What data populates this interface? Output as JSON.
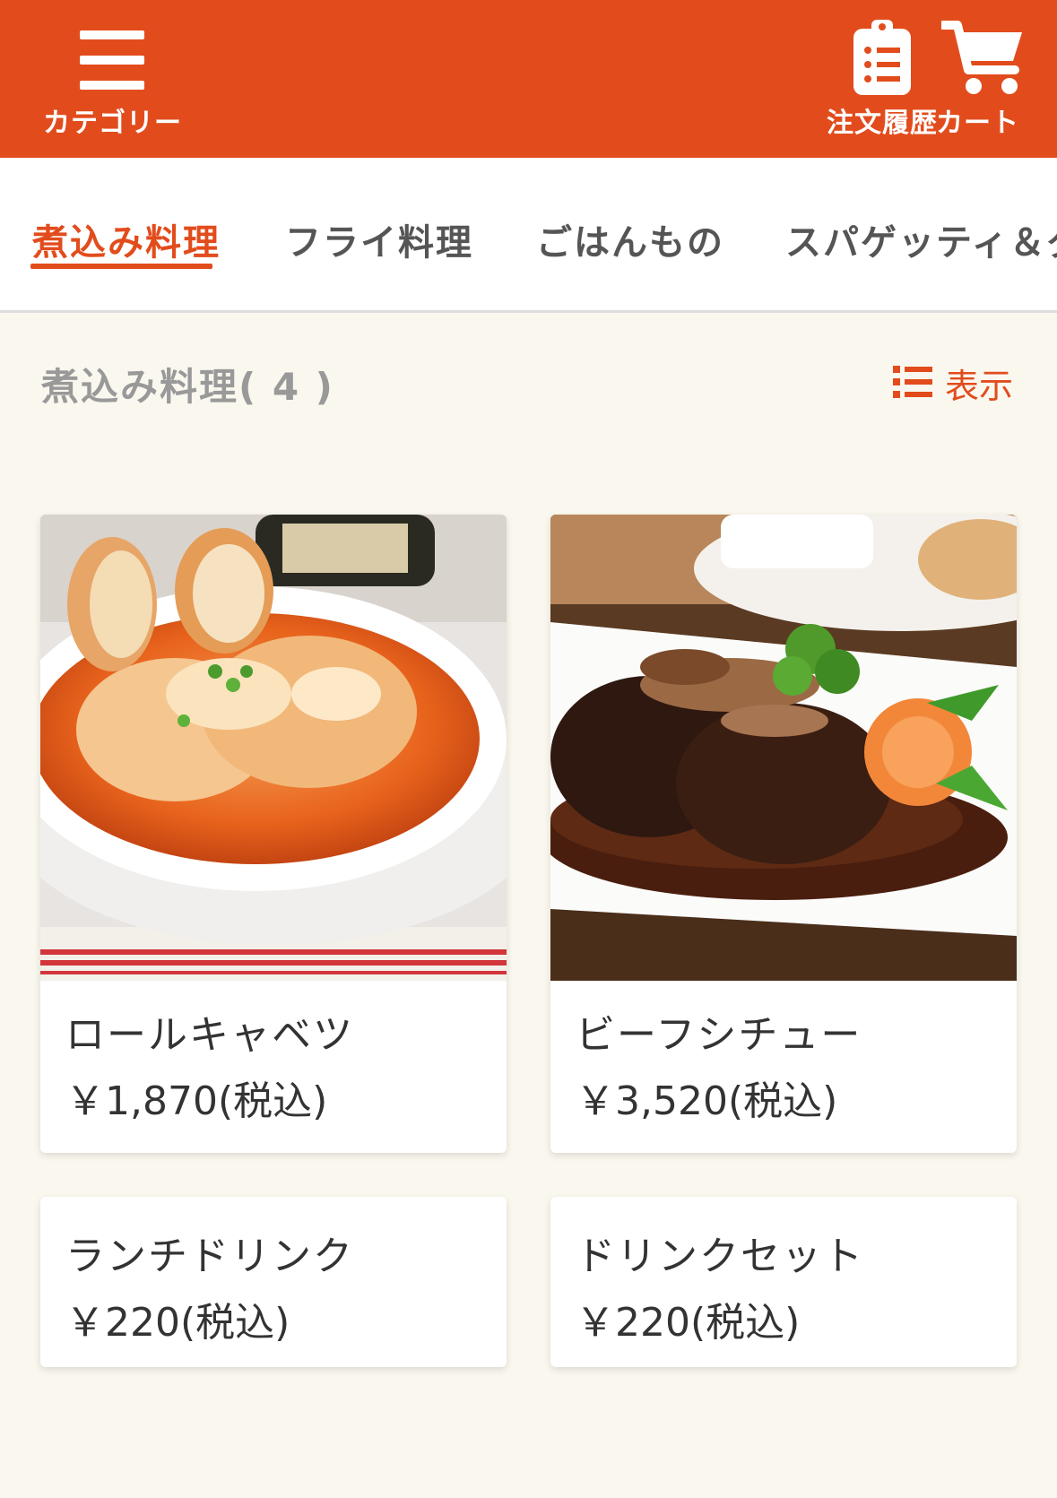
{
  "header": {
    "menu_label": "カテゴリー",
    "history_label": "注文履歴",
    "cart_label": "カート",
    "background_color": "#e24c1c",
    "icons": {
      "menu": "hamburger-icon",
      "history": "clipboard-list-icon",
      "cart": "shopping-cart-icon"
    }
  },
  "tabs": [
    {
      "label": "煮込み料理",
      "active": true
    },
    {
      "label": "フライ料理",
      "active": false
    },
    {
      "label": "ごはんもの",
      "active": false
    },
    {
      "label": "スパゲッティ＆グ",
      "active": false
    }
  ],
  "section": {
    "title": "煮込み料理( 4 )",
    "display_label": "表示",
    "display_icon": "list-icon"
  },
  "items": [
    {
      "name": "ロールキャベツ",
      "price": "￥1,870(税込)",
      "image": "cabbage-roll-photo"
    },
    {
      "name": "ビーフシチュー",
      "price": "￥3,520(税込)",
      "image": "beef-stew-photo"
    },
    {
      "name": "ランチドリンク",
      "price": "￥220(税込)"
    },
    {
      "name": "ドリンクセット",
      "price": "￥220(税込)"
    }
  ],
  "colors": {
    "accent": "#e24c1c",
    "background": "#faf7ee"
  }
}
